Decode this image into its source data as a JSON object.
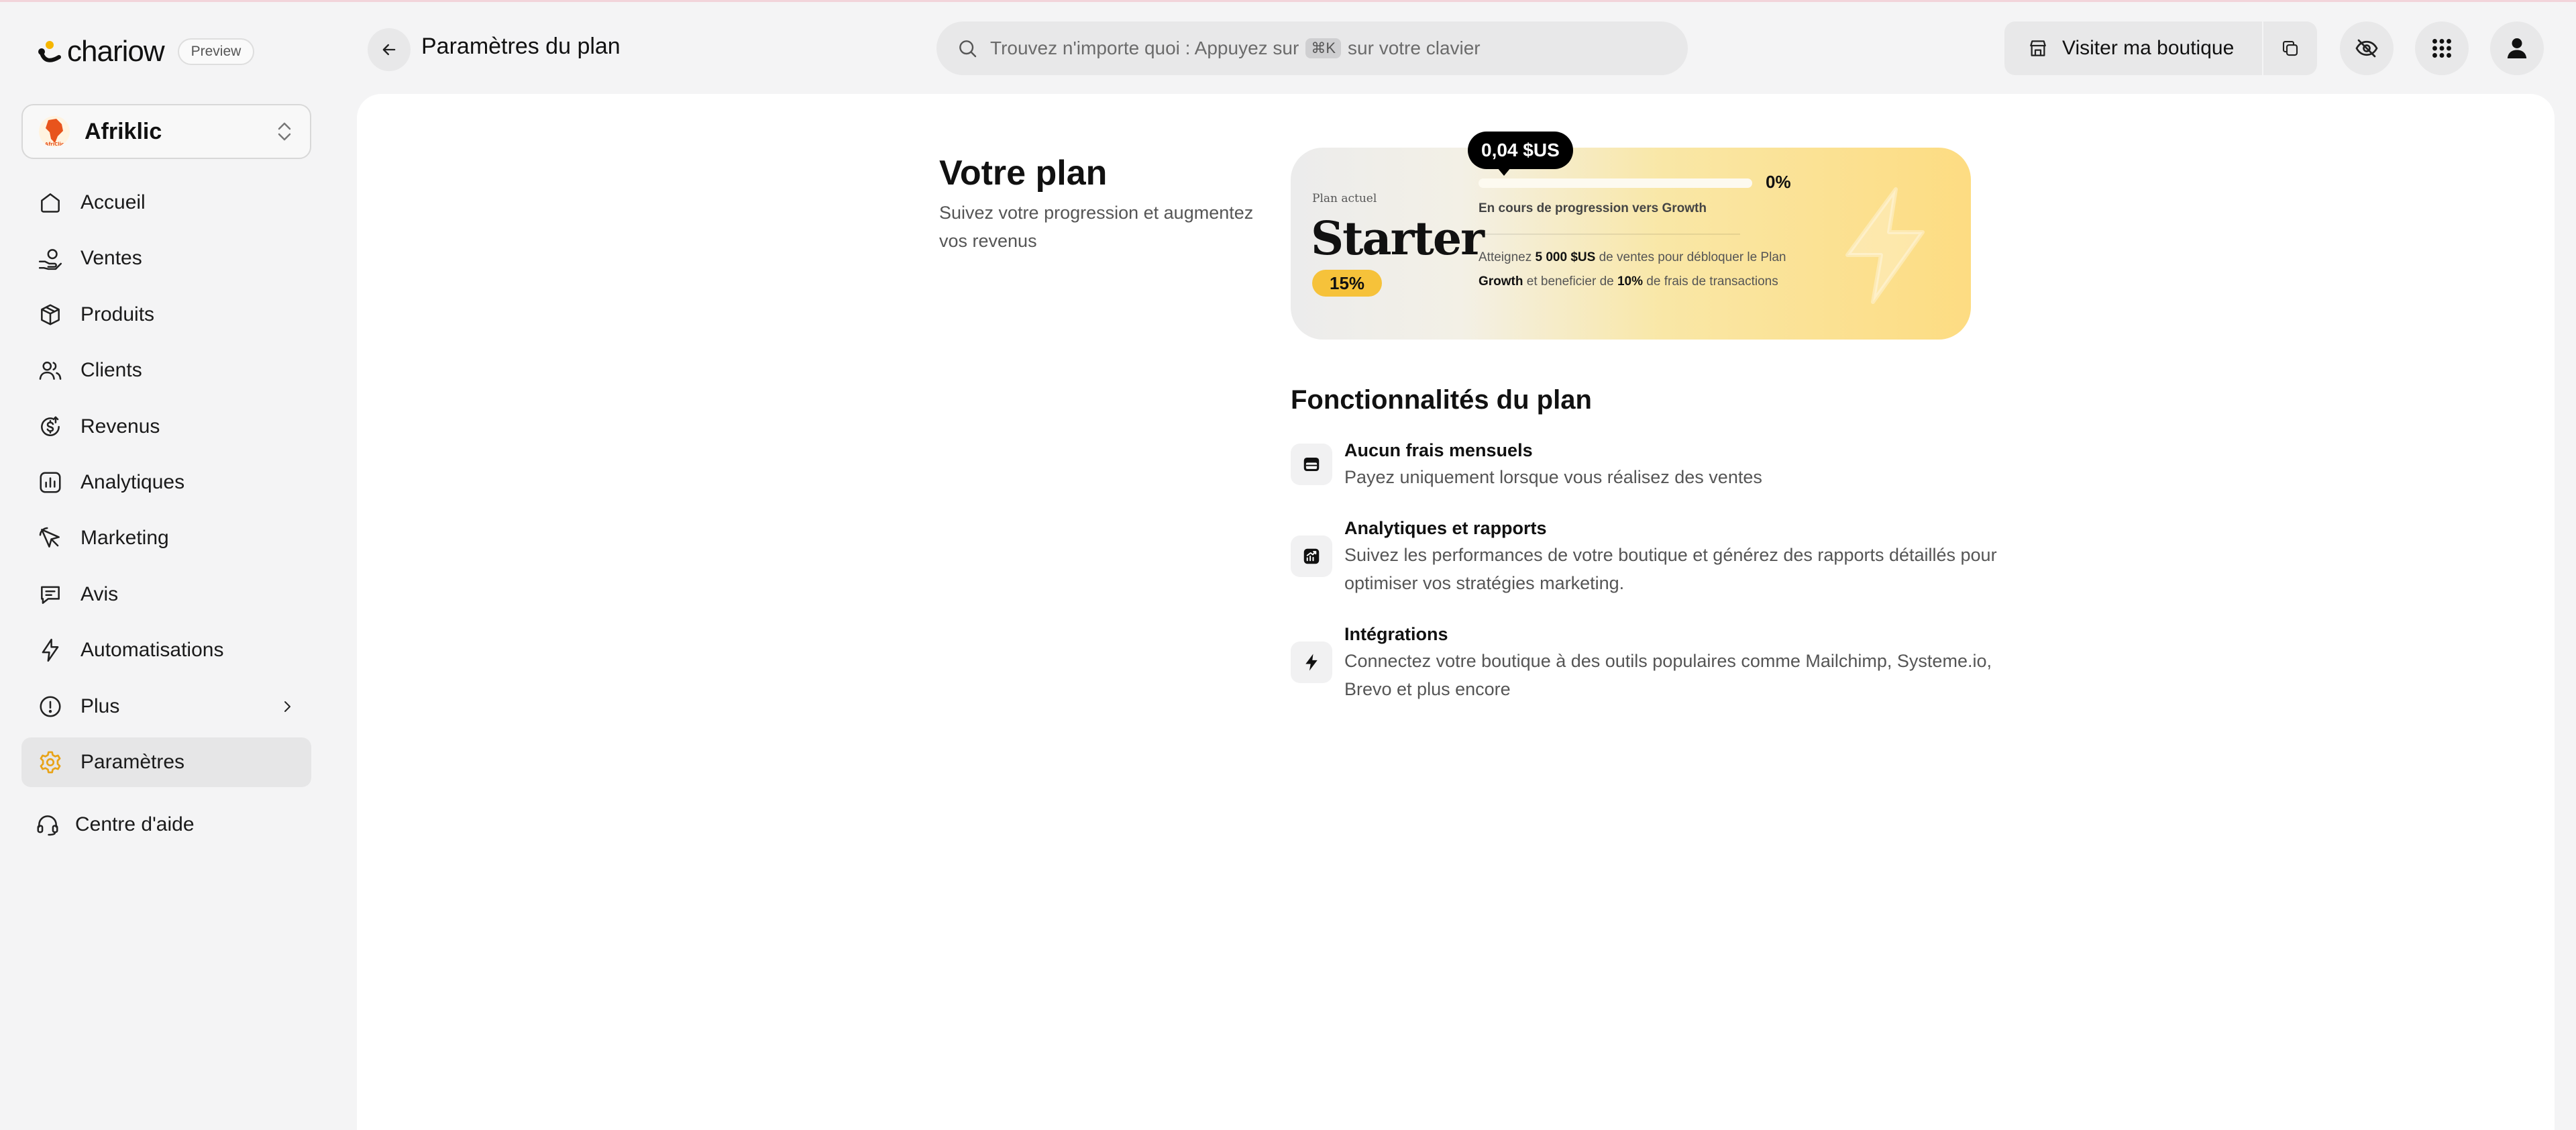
{
  "brand": {
    "logo_text": "chariow",
    "preview_badge": "Preview"
  },
  "shop": {
    "name": "Afriklic",
    "avatar_text": "AfriClic"
  },
  "sidebar": {
    "items": [
      {
        "label": "Accueil",
        "icon": "home-icon"
      },
      {
        "label": "Ventes",
        "icon": "money-hand-icon"
      },
      {
        "label": "Produits",
        "icon": "box-icon"
      },
      {
        "label": "Clients",
        "icon": "users-icon"
      },
      {
        "label": "Revenus",
        "icon": "dollar-circle-icon"
      },
      {
        "label": "Analytiques",
        "icon": "bar-chart-icon"
      },
      {
        "label": "Marketing",
        "icon": "pointer-icon"
      },
      {
        "label": "Avis",
        "icon": "message-icon"
      },
      {
        "label": "Automatisations",
        "icon": "lightning-icon"
      },
      {
        "label": "Plus",
        "icon": "info-circle-icon"
      },
      {
        "label": "Paramètres",
        "icon": "gear-icon",
        "active": true
      }
    ],
    "help": {
      "label": "Centre d'aide",
      "icon": "headset-icon"
    }
  },
  "header": {
    "title": "Paramètres du plan",
    "search": {
      "before": "Trouvez n'importe quoi : Appuyez sur",
      "kbd": "⌘K",
      "after": "sur votre clavier"
    },
    "visit_label": "Visiter ma boutique"
  },
  "plan": {
    "heading": "Votre plan",
    "subheading": "Suivez votre progression et augmentez vos revenus",
    "current_label": "Plan actuel",
    "name": "Starter",
    "fee": "15%",
    "amount": "0,04 $US",
    "progress_pct_label": "0%",
    "progress_fraction": 0.0,
    "progress_label": "En cours de progression vers Growth",
    "unlock": {
      "t1": "Atteignez",
      "amount": "5 000 $US",
      "t2": "de ventes pour débloquer le Plan",
      "plan": "Growth",
      "t3": "et beneficier de",
      "fee": "10%",
      "t4": "de frais de transactions"
    },
    "accent_color": "#f6c23a"
  },
  "features": {
    "title": "Fonctionnalités du plan",
    "items": [
      {
        "title": "Aucun frais mensuels",
        "desc": "Payez uniquement lorsque vous réalisez des ventes",
        "icon": "wallet-icon"
      },
      {
        "title": "Analytiques et rapports",
        "desc": "Suivez les performances de votre boutique et générez des rapports détaillés pour optimiser vos stratégies marketing.",
        "icon": "chart-up-icon"
      },
      {
        "title": "Intégrations",
        "desc": "Connectez votre boutique à des outils populaires comme Mailchimp, Systeme.io, Brevo et plus encore",
        "icon": "lightning-icon"
      }
    ]
  }
}
